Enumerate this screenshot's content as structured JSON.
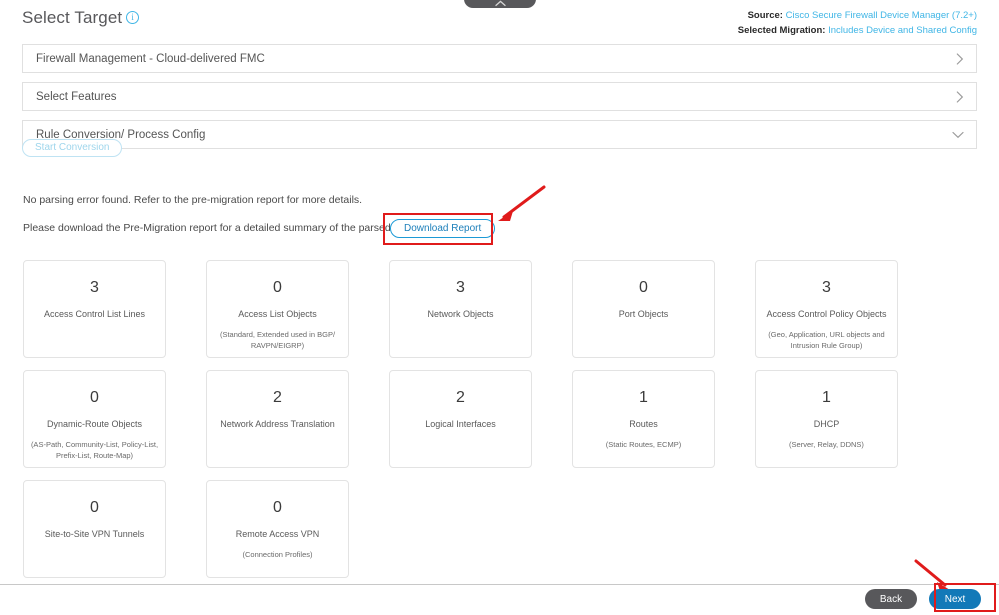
{
  "header": {
    "title": "Select Target",
    "info_icon": "info-icon",
    "source_label": "Source:",
    "source_value": "Cisco Secure Firewall Device Manager (7.2+)",
    "migration_label": "Selected Migration:",
    "migration_value": "Includes Device and Shared Config"
  },
  "collapse_tab": {
    "icon": "chevron-up-icon"
  },
  "accordion": [
    {
      "label": "Firewall Management - Cloud-delivered FMC",
      "state": "collapsed",
      "icon": "chevron-right-icon"
    },
    {
      "label": "Select Features",
      "state": "collapsed",
      "icon": "chevron-right-icon"
    },
    {
      "label": "Rule Conversion/ Process Config",
      "state": "expanded",
      "icon": "chevron-down-icon"
    }
  ],
  "actions": {
    "start_conversion": "Start Conversion",
    "download_report": "Download Report"
  },
  "messages": {
    "parsing": "No parsing error found. Refer to the pre-migration report for more details.",
    "download_hint": "Please download the Pre-Migration report for a detailed summary of the parsed configuration."
  },
  "cards": [
    [
      {
        "count": "3",
        "name": "Access Control List Lines",
        "sub": ""
      },
      {
        "count": "0",
        "name": "Access List Objects",
        "sub": "(Standard, Extended used in BGP/ RAVPN/EIGRP)"
      },
      {
        "count": "3",
        "name": "Network Objects",
        "sub": ""
      },
      {
        "count": "0",
        "name": "Port Objects",
        "sub": ""
      },
      {
        "count": "3",
        "name": "Access Control Policy Objects",
        "sub": "(Geo, Application, URL objects and Intrusion Rule Group)"
      }
    ],
    [
      {
        "count": "0",
        "name": "Dynamic-Route Objects",
        "sub": "(AS-Path, Community-List, Policy-List, Prefix-List, Route-Map)"
      },
      {
        "count": "2",
        "name": "Network Address Translation",
        "sub": ""
      },
      {
        "count": "2",
        "name": "Logical Interfaces",
        "sub": ""
      },
      {
        "count": "1",
        "name": "Routes",
        "sub": "(Static Routes, ECMP)"
      },
      {
        "count": "1",
        "name": "DHCP",
        "sub": "(Server, Relay, DDNS)"
      }
    ],
    [
      {
        "count": "0",
        "name": "Site-to-Site VPN Tunnels",
        "sub": ""
      },
      {
        "count": "0",
        "name": "Remote Access VPN",
        "sub": "(Connection Profiles)"
      }
    ]
  ],
  "footer": {
    "back": "Back",
    "next": "Next"
  },
  "annotations": {
    "highlight_color": "#e01b1b",
    "arrow_download_report": "red-arrow-icon",
    "arrow_next": "red-arrow-icon"
  },
  "colors": {
    "accent_blue": "#1279b8",
    "link_blue": "#41b6e6",
    "dark_gray": "#58585b"
  }
}
